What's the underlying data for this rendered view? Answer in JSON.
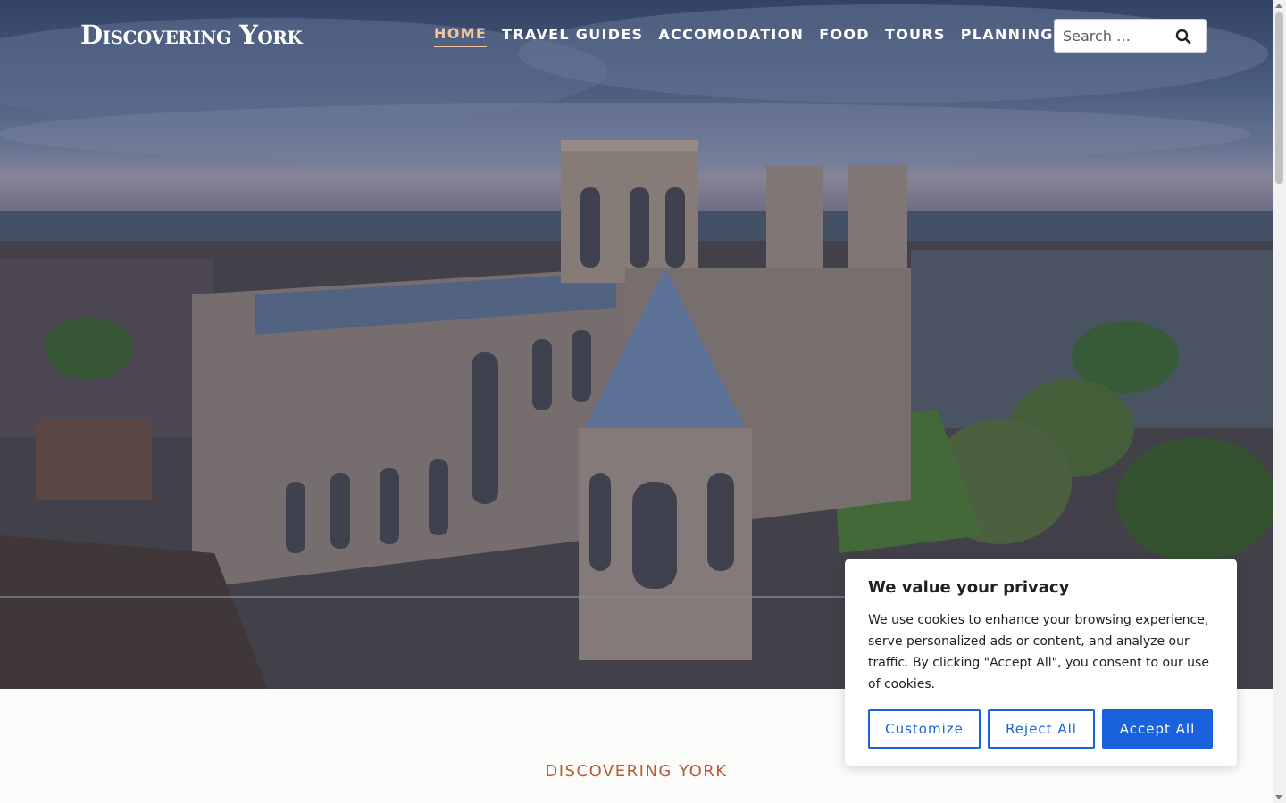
{
  "site": {
    "logo": "Discovering York"
  },
  "nav": {
    "items": [
      {
        "label": "Home",
        "active": true
      },
      {
        "label": "Travel Guides",
        "active": false
      },
      {
        "label": "Accomodation",
        "active": false
      },
      {
        "label": "Food",
        "active": false
      },
      {
        "label": "Tours",
        "active": false
      },
      {
        "label": "Planning",
        "active": false,
        "has_dropdown": true
      }
    ]
  },
  "search": {
    "placeholder": "Search …",
    "icon": "search-icon"
  },
  "section": {
    "title": "DISCOVERING YORK"
  },
  "cookie_banner": {
    "title": "We value your privacy",
    "body": "We use cookies to enhance your browsing experience, serve personalized ads or content, and analyze our traffic. By clicking \"Accept All\", you consent to our use of cookies.",
    "customize_label": "Customize",
    "reject_label": "Reject All",
    "accept_label": "Accept All"
  },
  "colors": {
    "accent_nav_active": "#f2c59a",
    "section_title": "#b85a33",
    "button_blue": "#1863dc"
  }
}
